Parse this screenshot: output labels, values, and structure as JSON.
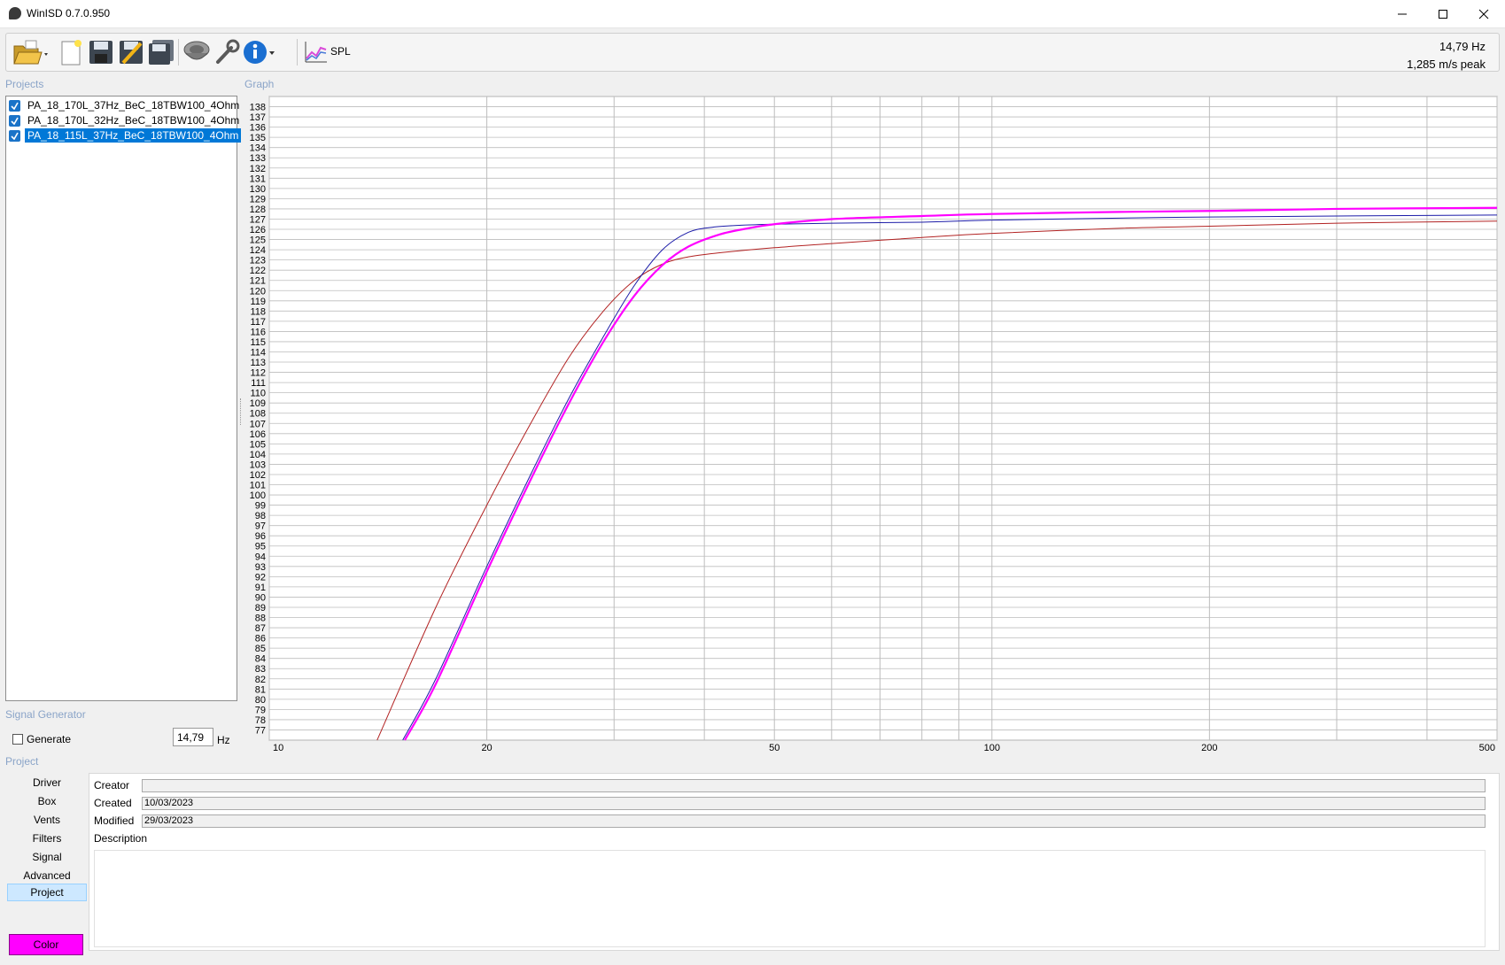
{
  "window": {
    "title": "WinISD 0.7.0.950"
  },
  "toolbar": {
    "icons": [
      "open-folder-icon",
      "new-document-icon",
      "save-icon",
      "save-as-icon",
      "save-all-icon",
      "driver-speaker-icon",
      "wrench-icon",
      "info-icon",
      "spl-graph-icon"
    ],
    "spl_label": "SPL",
    "readout_freq": "14,79 Hz",
    "readout_velocity": "1,285 m/s peak"
  },
  "sections": {
    "projects": "Projects",
    "graph": "Graph",
    "signal_generator": "Signal Generator",
    "project": "Project"
  },
  "projects": [
    {
      "name": "PA_18_170L_37Hz_BeC_18TBW100_4Ohm",
      "checked": true,
      "selected": false,
      "color": "#b22222"
    },
    {
      "name": "PA_18_170L_32Hz_BeC_18TBW100_4Ohm",
      "checked": true,
      "selected": false,
      "color": "#1c1ca8"
    },
    {
      "name": "PA_18_115L_37Hz_BeC_18TBW100_4Ohm",
      "checked": true,
      "selected": true,
      "color": "#ff00ff"
    }
  ],
  "signal_generator": {
    "generate_label": "Generate",
    "generate_checked": false,
    "frequency_value": "14,79",
    "unit": "Hz"
  },
  "project_nav": {
    "items": [
      "Driver",
      "Box",
      "Vents",
      "Filters",
      "Signal",
      "Advanced",
      "Project"
    ],
    "active": "Project",
    "color_button": "Color",
    "color_value": "#ff00ff"
  },
  "project_panel": {
    "creator_label": "Creator",
    "creator_value": "",
    "created_label": "Created",
    "created_value": "10/03/2023",
    "modified_label": "Modified",
    "modified_value": "29/03/2023",
    "description_label": "Description",
    "description_value": ""
  },
  "chart_data": {
    "type": "line",
    "title": "",
    "xlabel": "",
    "ylabel": "",
    "x_scale": "log",
    "xlim": [
      10,
      500
    ],
    "ylim": [
      76,
      139
    ],
    "x_tick_labels": [
      "10",
      "20",
      "50",
      "100",
      "200",
      "500"
    ],
    "y_tick_labels": [
      "77",
      "78",
      "79",
      "80",
      "81",
      "82",
      "83",
      "84",
      "85",
      "86",
      "87",
      "88",
      "89",
      "90",
      "91",
      "92",
      "93",
      "94",
      "95",
      "96",
      "97",
      "98",
      "99",
      "100",
      "101",
      "102",
      "103",
      "104",
      "105",
      "106",
      "107",
      "108",
      "109",
      "110",
      "111",
      "112",
      "113",
      "114",
      "115",
      "116",
      "117",
      "118",
      "119",
      "120",
      "121",
      "122",
      "123",
      "124",
      "125",
      "126",
      "127",
      "128",
      "129",
      "130",
      "131",
      "132",
      "133",
      "134",
      "135",
      "136",
      "137",
      "138"
    ],
    "grid": true,
    "series": [
      {
        "color": "#b22222",
        "x": [
          14.1,
          17,
          20,
          23,
          26,
          29,
          32,
          35,
          38,
          42,
          50,
          60,
          80,
          100,
          150,
          200,
          300,
          500
        ],
        "y": [
          76,
          89,
          99,
          107,
          113.5,
          118,
          121,
          122.6,
          123.3,
          123.7,
          124.2,
          124.6,
          125.2,
          125.6,
          126.1,
          126.3,
          126.6,
          126.8
        ]
      },
      {
        "color": "#1c1ca8",
        "x": [
          15.3,
          17,
          20,
          23,
          26,
          29,
          32,
          35,
          38,
          41,
          45,
          50,
          60,
          80,
          100,
          150,
          200,
          300,
          500
        ],
        "y": [
          76,
          82,
          93,
          102,
          109.5,
          115.5,
          120.5,
          124,
          125.7,
          126.2,
          126.4,
          126.5,
          126.6,
          126.7,
          126.9,
          127.1,
          127.2,
          127.3,
          127.4
        ]
      },
      {
        "color": "#ff00ff",
        "x": [
          15.4,
          17,
          20,
          23,
          26,
          29,
          32,
          35,
          38,
          42,
          46,
          50,
          60,
          80,
          100,
          150,
          200,
          300,
          500
        ],
        "y": [
          76,
          81.5,
          92.5,
          101.5,
          109,
          115,
          119.5,
          122.5,
          124.3,
          125.5,
          126.1,
          126.5,
          127,
          127.3,
          127.5,
          127.7,
          127.8,
          128,
          128.1
        ]
      }
    ]
  }
}
